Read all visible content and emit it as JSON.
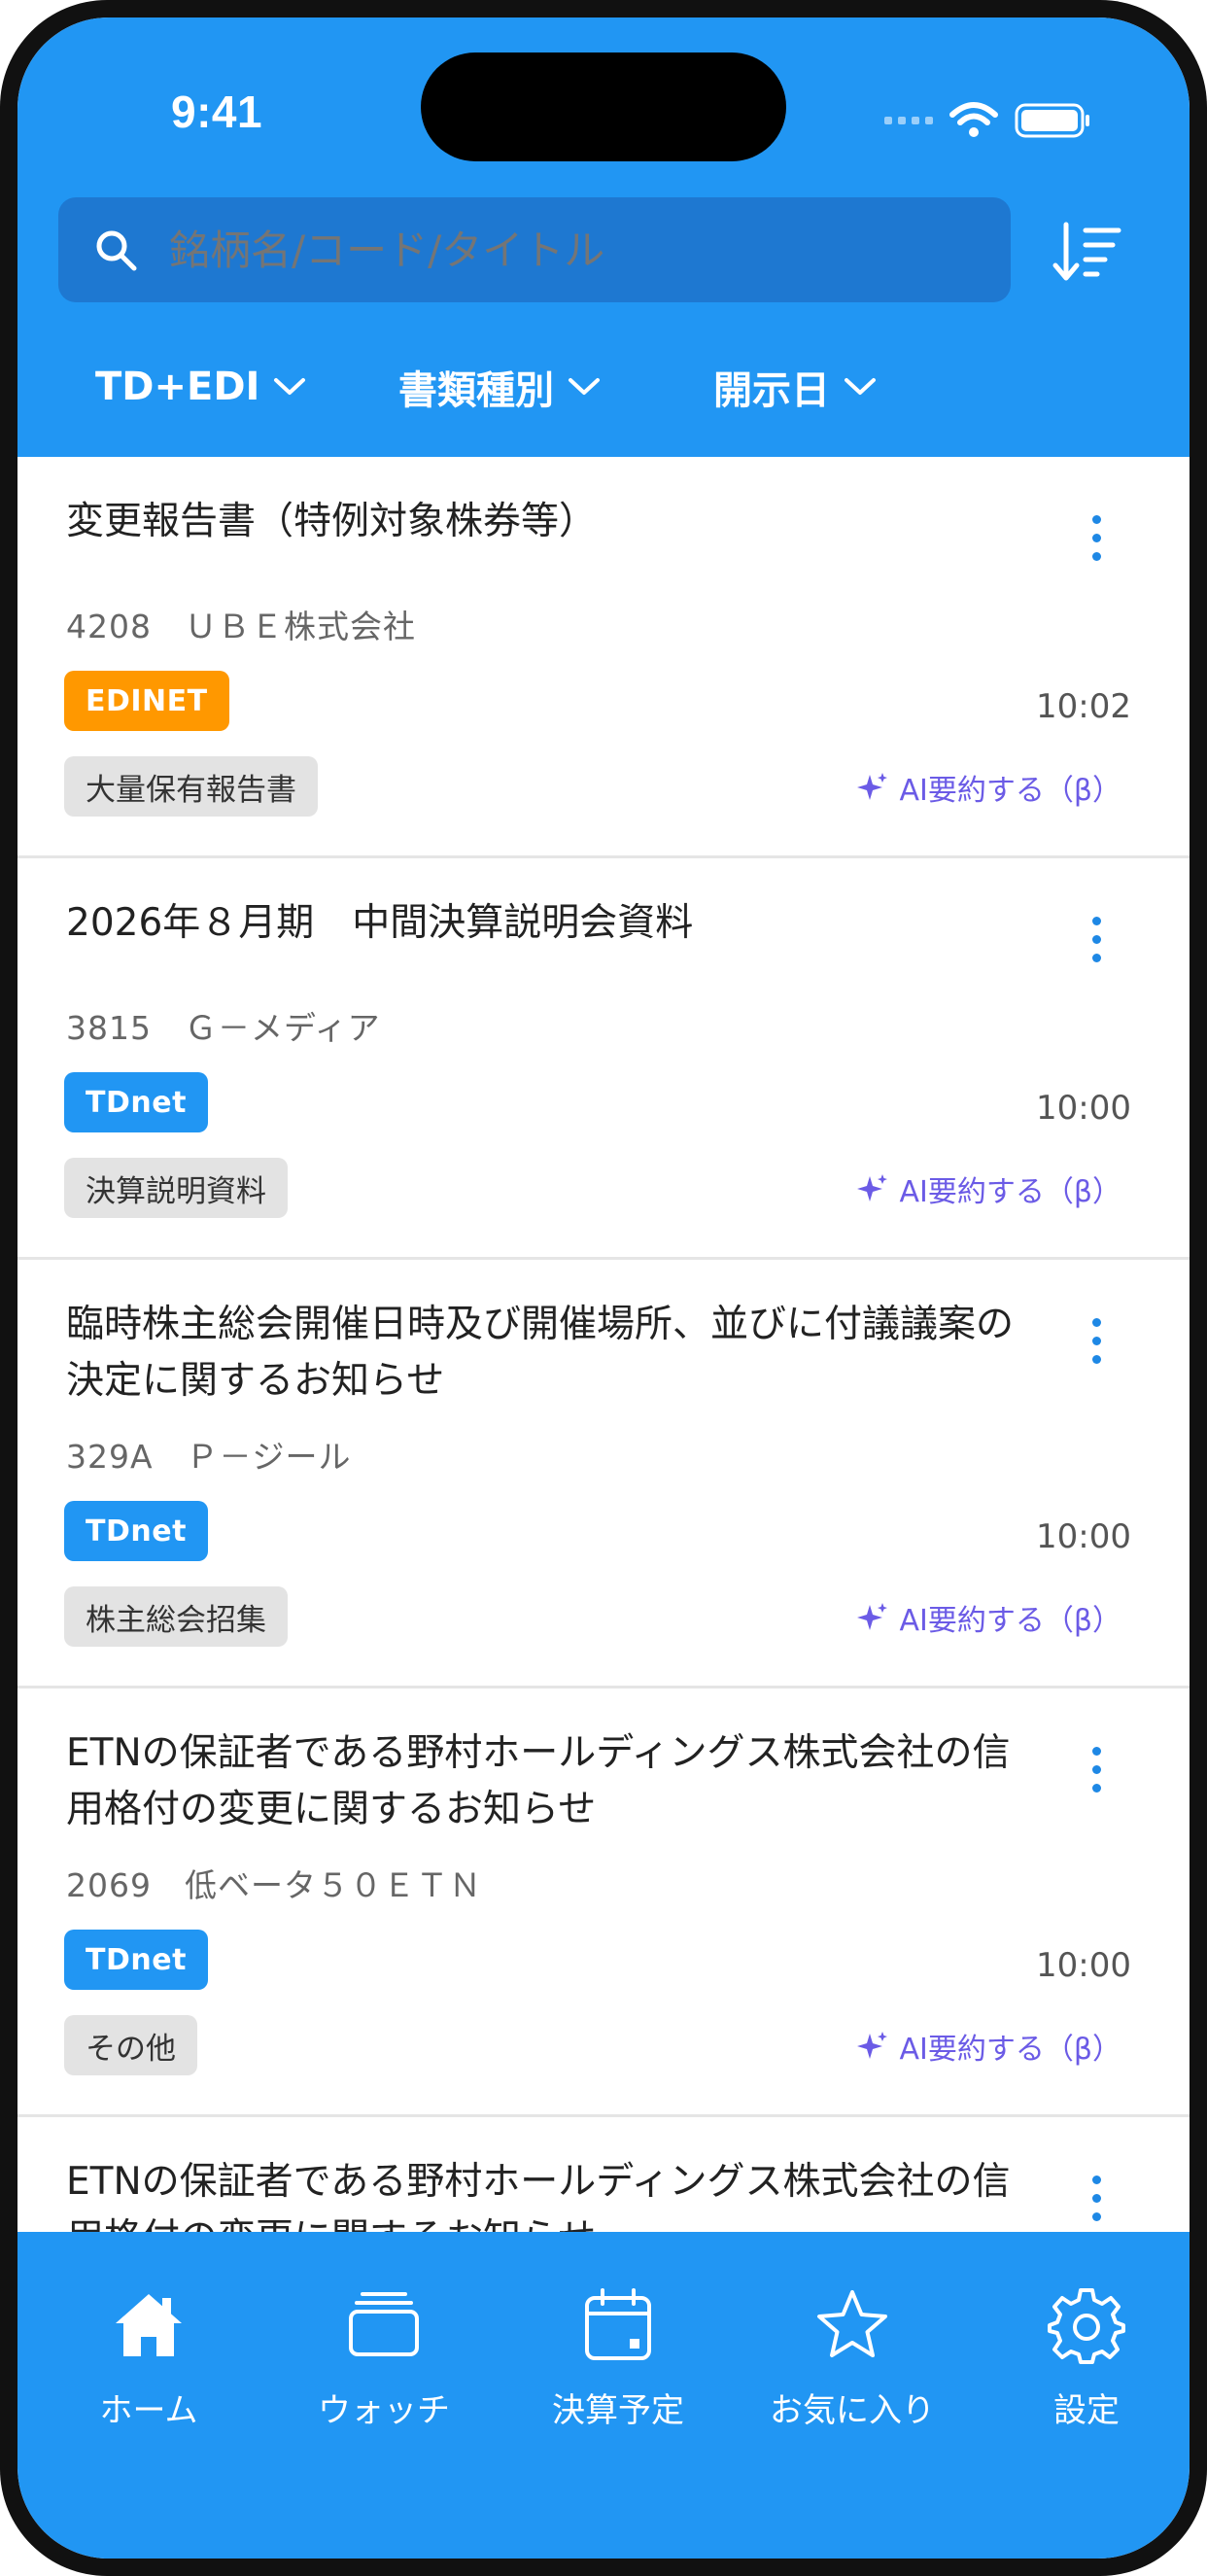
{
  "status_bar": {
    "time": "9:41"
  },
  "search": {
    "placeholder": "銘柄名/コード/タイトル"
  },
  "filters": [
    {
      "label": "TD+EDI"
    },
    {
      "label": "書類種別"
    },
    {
      "label": "開示日"
    }
  ],
  "ai_summary_label": "AI要約する（β）",
  "items": [
    {
      "title": "変更報告書（特例対象株券等）",
      "code": "4208　ＵＢＥ株式会社",
      "source": "EDINET",
      "time": "10:02",
      "doctype": "大量保有報告書"
    },
    {
      "title": "2026年８月期　中間決算説明会資料",
      "code": "3815　Ｇ－メディア",
      "source": "TDnet",
      "time": "10:00",
      "doctype": "決算説明資料"
    },
    {
      "title": "臨時株主総会開催日時及び開催場所、並びに付議議案の決定に関するお知らせ",
      "code": "329A　Ｐ－ジール",
      "source": "TDnet",
      "time": "10:00",
      "doctype": "株主総会招集"
    },
    {
      "title": "ETNの保証者である野村ホールディングス株式会社の信用格付の変更に関するお知らせ",
      "code": "2069　低ベータ５０ＥＴＮ",
      "source": "TDnet",
      "time": "10:00",
      "doctype": "その他"
    },
    {
      "title": "ETNの保証者である野村ホールディングス株式会社の信用格付の変更に関するお知らせ"
    }
  ],
  "tabs": [
    {
      "label": "ホーム",
      "icon": "home-icon"
    },
    {
      "label": "ウォッチ",
      "icon": "stack-icon"
    },
    {
      "label": "決算予定",
      "icon": "calendar-icon"
    },
    {
      "label": "お気に入り",
      "icon": "star-icon"
    },
    {
      "label": "設定",
      "icon": "gear-icon"
    }
  ],
  "colors": {
    "primary": "#2196F3",
    "edinet": "#FF9800",
    "ai": "#6B5BE6"
  }
}
